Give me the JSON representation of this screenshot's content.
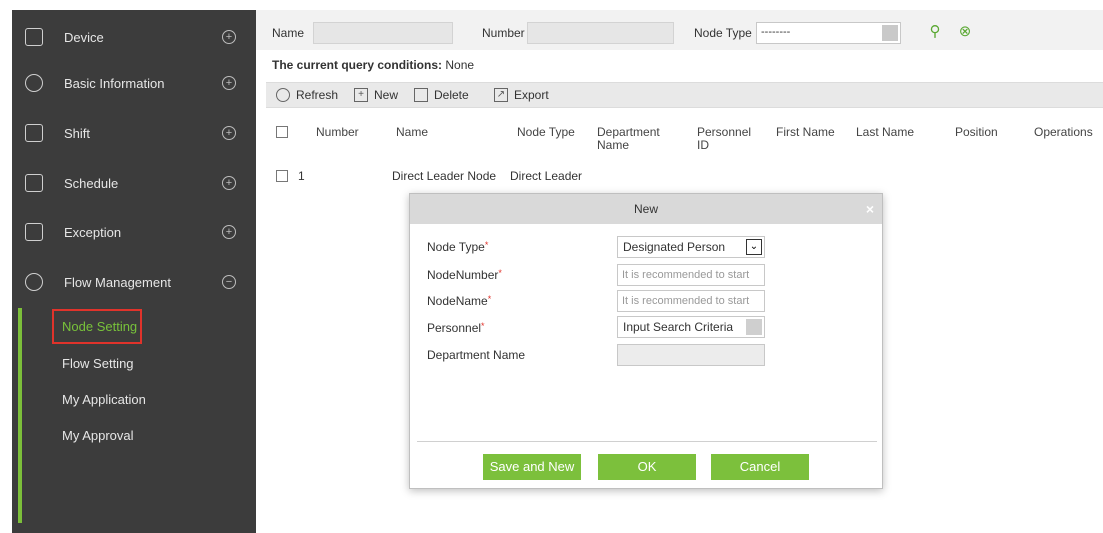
{
  "sidebar": {
    "menu": [
      {
        "label": "Device",
        "icon": "device-icon"
      },
      {
        "label": "Basic Information",
        "icon": "basic-info-icon"
      },
      {
        "label": "Shift",
        "icon": "shift-icon"
      },
      {
        "label": "Schedule",
        "icon": "schedule-icon"
      },
      {
        "label": "Exception",
        "icon": "exception-icon"
      },
      {
        "label": "Flow Management",
        "icon": "flow-management-icon"
      }
    ],
    "expand_symbol": "+",
    "collapse_symbol": "−",
    "submenu": [
      {
        "label": "Node Setting",
        "active": true
      },
      {
        "label": "Flow Setting"
      },
      {
        "label": "My Application"
      },
      {
        "label": "My Approval"
      }
    ]
  },
  "query": {
    "name_label": "Name",
    "number_label": "Number",
    "node_type_label": "Node Type",
    "node_type_value": "--------",
    "search_icon": "search-icon",
    "clear_icon": "clear-icon",
    "conditions_label": "The current query conditions:",
    "conditions_value": "None"
  },
  "toolbar": {
    "refresh": "Refresh",
    "new": "New",
    "delete": "Delete",
    "export": "Export"
  },
  "table": {
    "columns": [
      "Number",
      "Name",
      "Node Type",
      "Department Name",
      "Personnel ID",
      "First Name",
      "Last Name",
      "Position",
      "Operations"
    ],
    "rows": [
      {
        "number": "1",
        "name": "Direct Leader Node",
        "node_type": "Direct Leader"
      }
    ]
  },
  "modal": {
    "title": "New",
    "close": "×",
    "fields": {
      "node_type": {
        "label": "Node Type",
        "value": "Designated Person"
      },
      "node_number": {
        "label": "NodeNumber",
        "placeholder": "It is recommended to start"
      },
      "node_name": {
        "label": "NodeName",
        "placeholder": "It is recommended to start"
      },
      "personnel": {
        "label": "Personnel",
        "value": "Input Search Criteria"
      },
      "department": {
        "label": "Department Name",
        "value": ""
      }
    },
    "required_mark": "*",
    "buttons": {
      "save_and_new": "Save and New",
      "ok": "OK",
      "cancel": "Cancel"
    }
  },
  "colors": {
    "sidebar_bg": "#3c3c3c",
    "accent_green": "#7cc03c",
    "highlight_red": "#e0332b"
  }
}
